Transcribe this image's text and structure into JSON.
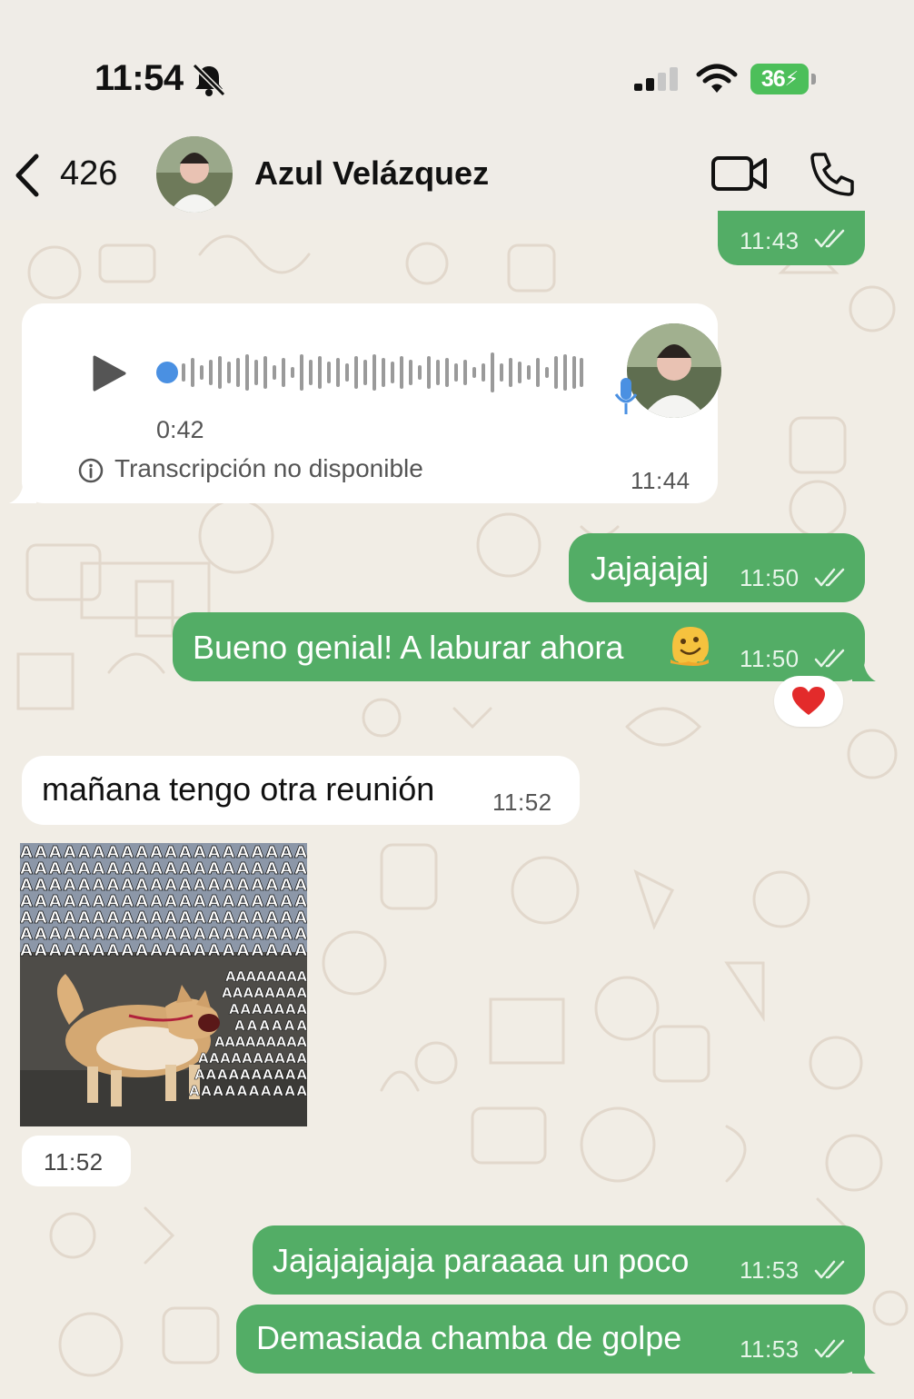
{
  "status_bar": {
    "time": "11:54",
    "battery": "36"
  },
  "header": {
    "back_count": "426",
    "contact_name": "Azul Velázquez"
  },
  "messages": [
    {
      "id": "m0",
      "direction": "out",
      "time": "11:43",
      "status": "read"
    },
    {
      "id": "m1",
      "direction": "in",
      "type": "voice",
      "duration": "0:42",
      "transcription": "Transcripción no disponible",
      "time": "11:44"
    },
    {
      "id": "m2",
      "direction": "out",
      "text": "Jajajajaj",
      "time": "11:50",
      "status": "read"
    },
    {
      "id": "m3",
      "direction": "out",
      "text": "Bueno genial! A laburar ahora",
      "emoji": "melting-face",
      "time": "11:50",
      "status": "read",
      "reaction": "❤️"
    },
    {
      "id": "m4",
      "direction": "in",
      "text": "mañana tengo otra reunión",
      "time": "11:52"
    },
    {
      "id": "m5",
      "direction": "in",
      "type": "sticker",
      "sticker_text": "AAAAAAAAAAAAAAAAAAAA",
      "time": "11:52"
    },
    {
      "id": "m6",
      "direction": "out",
      "text": "Jajajajajaja paraaaa un poco",
      "time": "11:53",
      "status": "read"
    },
    {
      "id": "m7",
      "direction": "out",
      "text": "Demasiada chamba de golpe",
      "time": "11:53",
      "status": "read"
    }
  ],
  "colors": {
    "outgoing_bubble": "#53ad66",
    "incoming_bubble": "#ffffff",
    "wallpaper": "#f1ede5",
    "voice_accent": "#4a90e2",
    "battery": "#4cbf5a"
  },
  "icons": {
    "back": "chevron-left-icon",
    "video": "video-camera-icon",
    "phone": "phone-icon",
    "play": "play-icon",
    "mic": "microphone-icon",
    "info": "info-icon",
    "bell_off": "bell-off-icon",
    "ticks": "double-check-icon"
  }
}
